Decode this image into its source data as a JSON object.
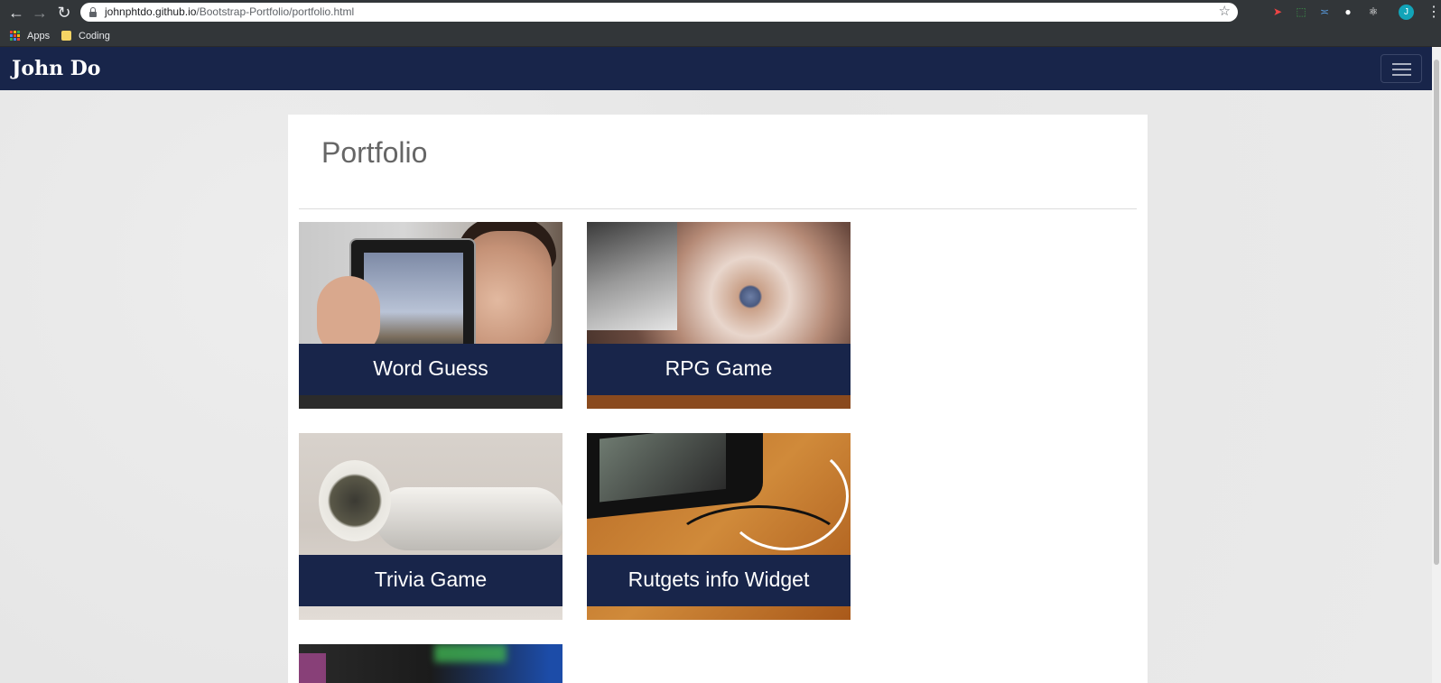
{
  "browser": {
    "url_host": "johnphtdo.github.io",
    "url_path": "/Bootstrap-Portfolio/portfolio.html",
    "profile_initial": "J",
    "bookmarks": [
      {
        "label": "Apps",
        "icon": "apps-icon"
      },
      {
        "label": "Coding",
        "icon": "folder-icon"
      }
    ]
  },
  "navbar": {
    "brand": "John Do",
    "brand_color": "#18254a"
  },
  "portfolio": {
    "title": "Portfolio",
    "items": [
      {
        "label": "Word Guess",
        "image": "tablet-photo"
      },
      {
        "label": "RPG Game",
        "image": "turntable-photo"
      },
      {
        "label": "Trivia Game",
        "image": "earbuds-photo"
      },
      {
        "label": "Rutgets info Widget",
        "image": "phone-photo"
      },
      {
        "label": "",
        "image": "monitor-photo"
      }
    ]
  }
}
